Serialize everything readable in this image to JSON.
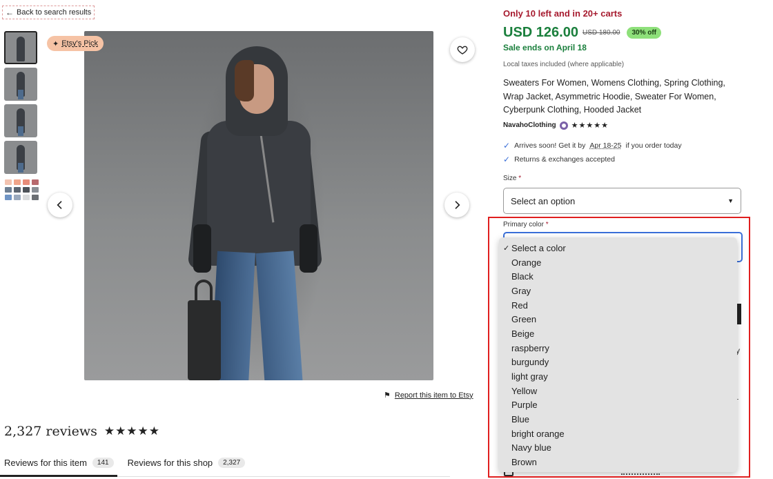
{
  "nav": {
    "back_label": "Back to search results"
  },
  "gallery": {
    "badge_label": "Etsy's Pick",
    "swatch_colors": [
      "#f2c3b0",
      "#f0a58a",
      "#e88d7a",
      "#b86a6e",
      "#6e7f92",
      "#5c6570",
      "#4d5258",
      "#8a8f95",
      "#6f94c4",
      "#9aa9bd",
      "#d9dbdc",
      "#6b6f73"
    ]
  },
  "report": {
    "label": "Report this item to Etsy"
  },
  "reviews": {
    "title": "2,327 reviews",
    "stars": "★★★★★",
    "tabs": [
      {
        "label": "Reviews for this item",
        "count": "141"
      },
      {
        "label": "Reviews for this shop",
        "count": "2,327"
      }
    ]
  },
  "product": {
    "stock_note": "Only 10 left and in 20+ carts",
    "price": "USD 126.00",
    "original_price": "USD 180.00",
    "discount": "30% off",
    "sale_ends": "Sale ends on April 18",
    "taxes_note": "Local taxes included (where applicable)",
    "title": "Sweaters For Women, Womens Clothing, Spring Clothing, Wrap Jacket, Asymmetric Hoodie, Sweater For Women, Cyberpunk Clothing, Hooded Jacket",
    "seller": "NavahoClothing",
    "seller_stars": "★★★★★",
    "perks": {
      "arrival_prefix": "Arrives soon! Get it by",
      "arrival_dates": "Apr 18-25",
      "arrival_suffix": "if you order today",
      "returns": "Returns & exchanges accepted"
    },
    "size": {
      "label": "Size",
      "required_mark": "*",
      "value": "Select an option"
    },
    "color": {
      "label": "Primary color",
      "required_mark": "*",
      "options": [
        "Select a color",
        "Orange",
        "Black",
        "Gray",
        "Red",
        "Green",
        "Beige",
        "raspberry",
        "burgundy",
        "light gray",
        "Yellow",
        "Purple",
        "Blue",
        "bright orange",
        "Navy blue",
        "Brown"
      ],
      "selected_index": 0
    }
  },
  "behind_dropdown": {
    "fragment_text": "y"
  },
  "colors": {
    "accent_green": "#1a7f3c",
    "stock_red": "#a61a2e",
    "discount_bg": "#8ee07a",
    "focus_blue": "#3a6fd8",
    "highlight_red": "#e01e1e"
  }
}
